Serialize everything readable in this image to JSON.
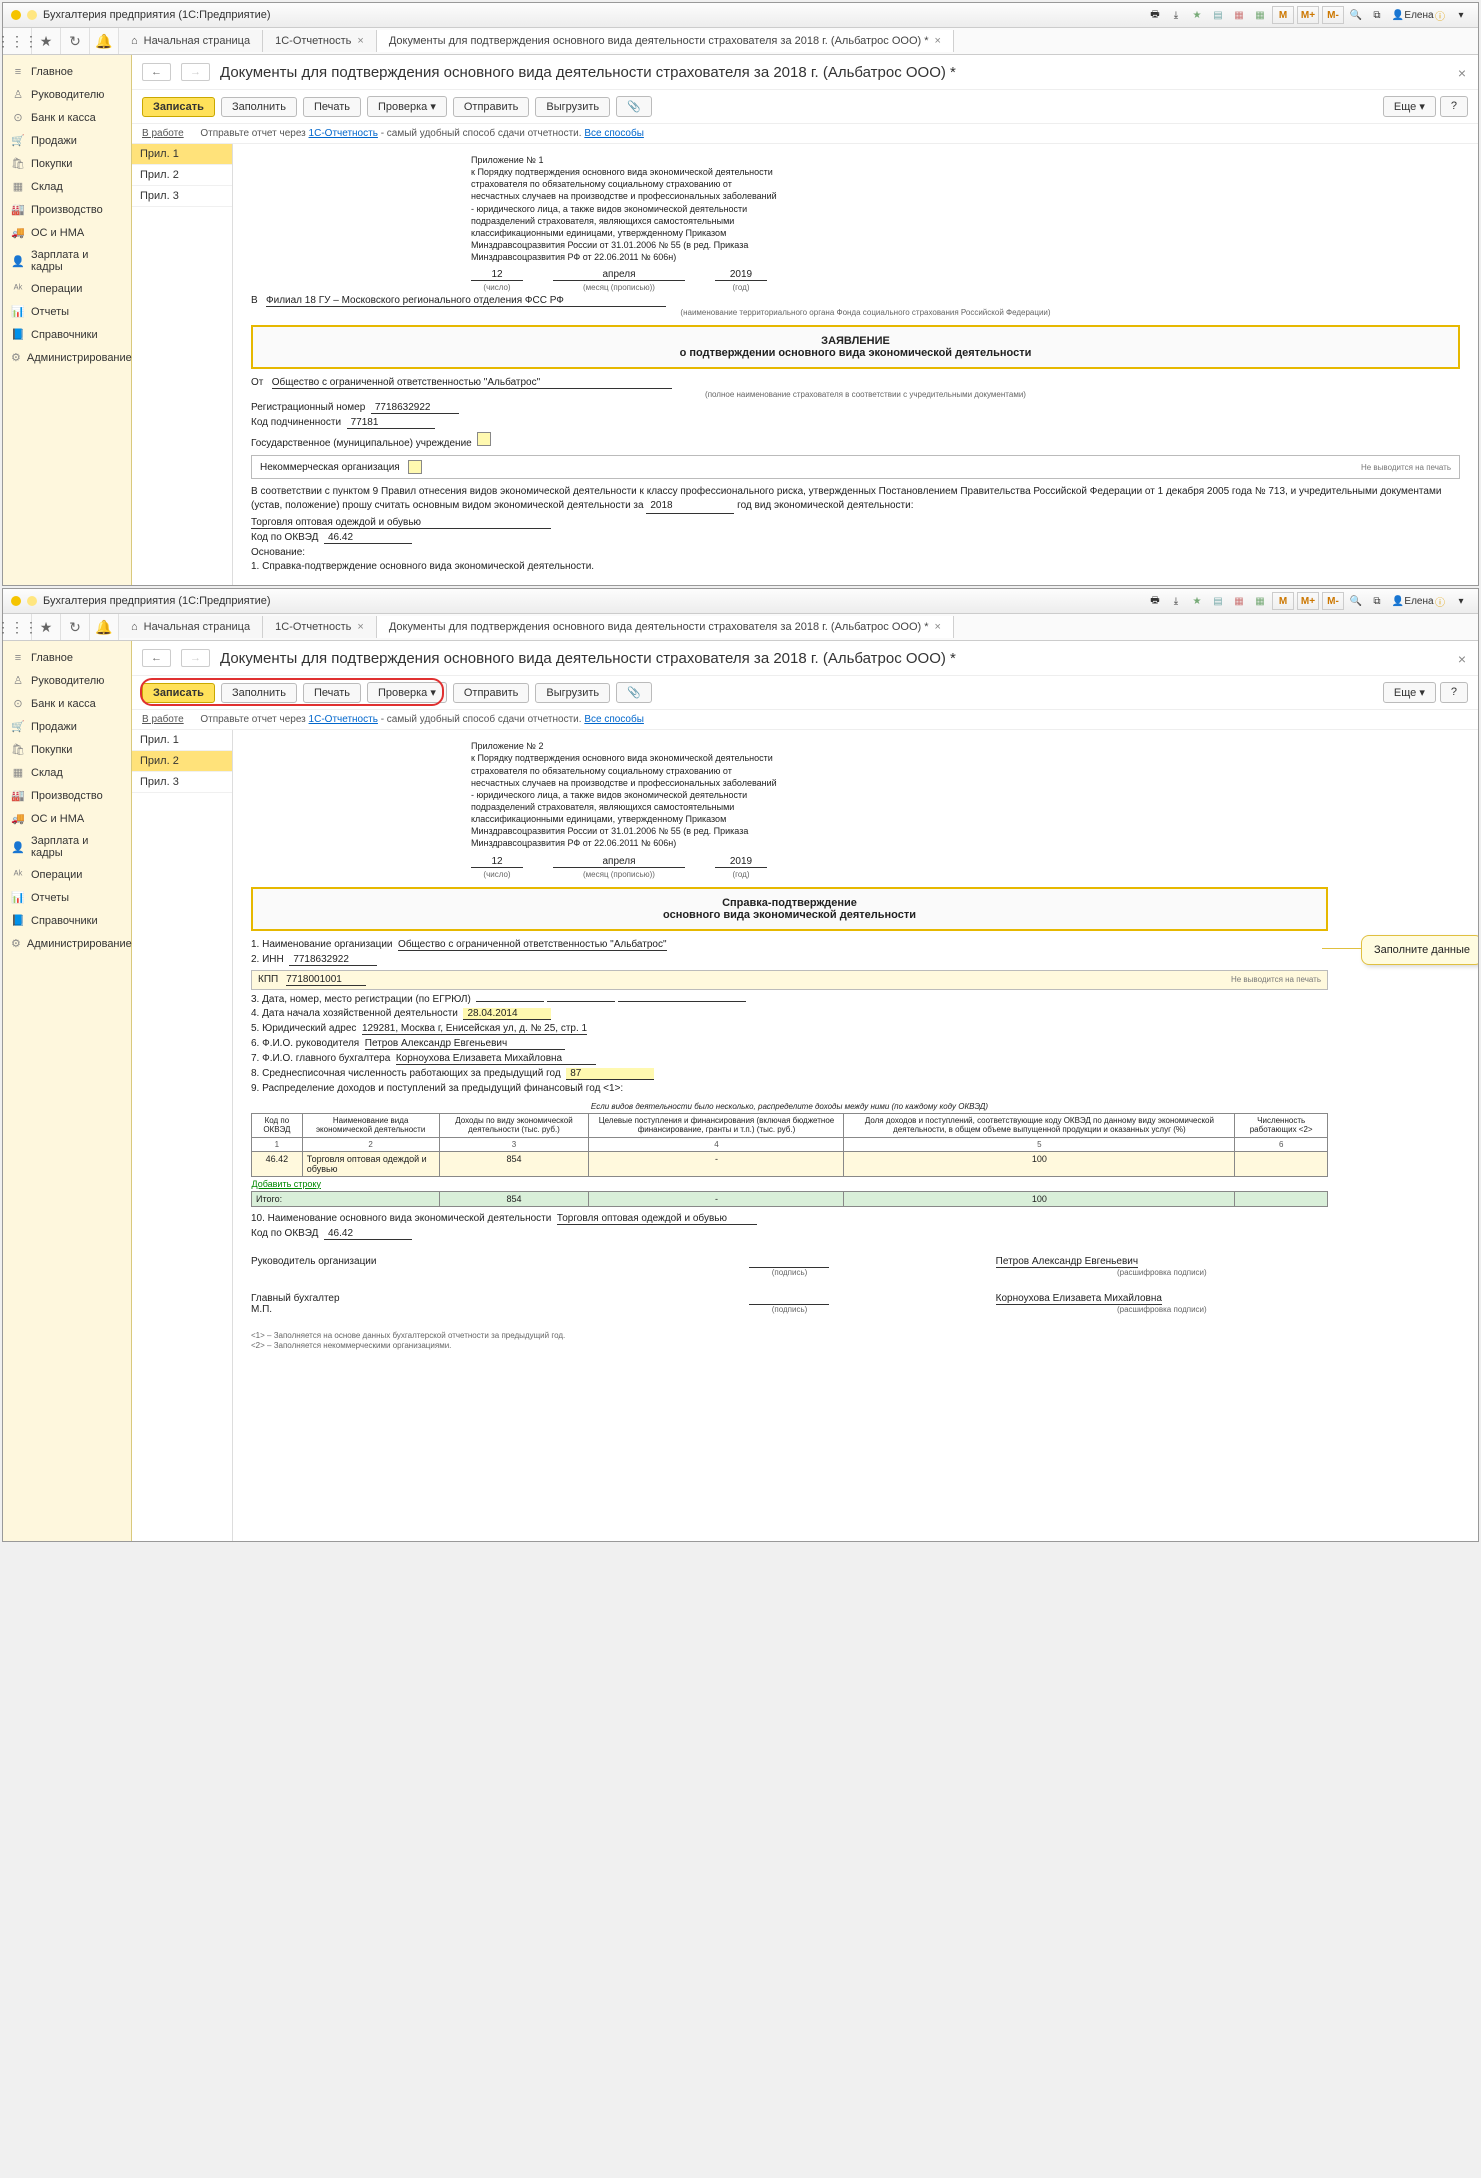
{
  "app": {
    "title": "Бухгалтерия предприятия   (1С:Предприятие)",
    "user": "Елена",
    "m_buttons": [
      "M",
      "M+",
      "M-"
    ]
  },
  "tabs": {
    "home": "Начальная страница",
    "t1": "1С-Отчетность",
    "t2": "Документы для подтверждения основного вида деятельности страхователя за 2018 г. (Альбатрос ООО) *"
  },
  "sidebar": [
    {
      "icon": "≡",
      "label": "Главное"
    },
    {
      "icon": "♙",
      "label": "Руководителю"
    },
    {
      "icon": "⊙",
      "label": "Банк и касса"
    },
    {
      "icon": "🛒",
      "label": "Продажи"
    },
    {
      "icon": "🛍",
      "label": "Покупки"
    },
    {
      "icon": "▦",
      "label": "Склад"
    },
    {
      "icon": "🏭",
      "label": "Производство"
    },
    {
      "icon": "🚚",
      "label": "ОС и НМА"
    },
    {
      "icon": "👤",
      "label": "Зарплата и кадры"
    },
    {
      "icon": "ᴬᵏ",
      "label": "Операции"
    },
    {
      "icon": "📊",
      "label": "Отчеты"
    },
    {
      "icon": "📘",
      "label": "Справочники"
    },
    {
      "icon": "⚙",
      "label": "Администрирование"
    }
  ],
  "page_title": "Документы для подтверждения основного вида деятельности страхователя за 2018 г. (Альбатрос ООО) *",
  "toolbar": {
    "save": "Записать",
    "fill": "Заполнить",
    "print": "Печать",
    "check": "Проверка",
    "send": "Отправить",
    "export": "Выгрузить",
    "more": "Еще"
  },
  "info": {
    "label": "В работе",
    "text1": "Отправьте отчет через ",
    "link1": "1С-Отчетность",
    "text2": " - самый удобный способ сдачи отчетности. ",
    "link2": "Все способы"
  },
  "attachments": [
    "Прил. 1",
    "Прил. 2",
    "Прил. 3"
  ],
  "doc1": {
    "appendix": "Приложение № 1",
    "appendix_text": "к Порядку подтверждения основного вида экономической деятельности страхователя по обязательному социальному страхованию от несчастных случаев на производстве и профессиональных заболеваний - юридического лица, а также видов экономической деятельности подразделений страхователя, являющихся самостоятельными классификационными единицами, утвержденному Приказом Минздравсоцразвития России от 31.01.2006 № 55 (в ред. Приказа Минздравсоцразвития РФ от 22.06.2011 № 606н)",
    "day": "12",
    "month": "апреля",
    "year": "2019",
    "day_l": "(число)",
    "month_l": "(месяц (прописью))",
    "year_l": "(год)",
    "to_l": "В",
    "to": "Филиал 18 ГУ – Московского регионального отделения ФСС РФ",
    "to_sub": "(наименование территориального органа Фонда социального страхования Российской Федерации)",
    "title1": "ЗАЯВЛЕНИЕ",
    "title2": "о подтверждении основного вида экономической деятельности",
    "from_l": "От",
    "from": "Общество с ограниченной ответственностью \"Альбатрос\"",
    "from_sub": "(полное наименование страхователя в соответствии с учредительными документами)",
    "reg_l": "Регистрационный номер",
    "reg": "7718632922",
    "sub_l": "Код подчиненности",
    "sub": "77181",
    "gos": "Государственное (муниципальное) учреждение",
    "nko": "Некоммерческая организация",
    "nko_note": "Не выводится на печать",
    "body": "В соответствии с пунктом 9 Правил отнесения видов экономической деятельности к классу профессионального риска, утвержденных Постановлением Правительства Российской Федерации от 1 декабря 2005 года № 713, и учредительными документами (устав, положение) прошу считать основным видом экономической деятельности за ",
    "body_year": "2018",
    "body2": " год вид экономической деятельности:",
    "activity": "Торговля оптовая одеждой и обувью",
    "okved_l": "Код по ОКВЭД",
    "okved": "46.42",
    "basis_l": "Основание:",
    "basis1": "1. Справка-подтверждение основного вида экономической деятельности."
  },
  "doc2": {
    "appendix": "Приложение № 2",
    "title1": "Справка-подтверждение",
    "title2": "основного вида экономической деятельности",
    "l1": "1. Наименование организации",
    "v1": "Общество с ограниченной ответственностью \"Альбатрос\"",
    "l2": "2. ИНН",
    "v2": "7718632922",
    "kpp_l": "КПП",
    "kpp": "7718001001",
    "kpp_note": "Не выводится на печать",
    "l3": "3. Дата, номер, место регистрации (по ЕГРЮЛ)",
    "l4": "4. Дата начала хозяйственной деятельности",
    "v4": "28.04.2014",
    "l5": "5. Юридический адрес",
    "v5": "129281, Москва г, Енисейская ул, д. № 25, стр. 1",
    "l6": "6. Ф.И.О. руководителя",
    "v6": "Петров Александр Евгеньевич",
    "l7": "7. Ф.И.О. главного бухгалтера",
    "v7": "Корноухова Елизавета Михайловна",
    "l8": "8. Среднесписочная численность работающих за предыдущий год",
    "v8": "87",
    "l9": "9. Распределение доходов и поступлений за предыдущий финансовый год <1>:",
    "tbl_note": "Если видов деятельности было несколько, распределите доходы между ними (по каждому коду ОКВЭД)",
    "th": [
      "Код по ОКВЭД",
      "Наименование вида экономической деятельности",
      "Доходы по виду экономической деятельности (тыс. руб.)",
      "Целевые поступления и финансирования (включая бюджетное финансирование, гранты и т.п.) (тыс. руб.)",
      "Доля доходов и поступлений, соответствующие коду ОКВЭД по данному виду экономической деятельности, в общем объеме выпущенной продукции и оказанных услуг (%)",
      "Численность работающих <2>"
    ],
    "row": [
      "46.42",
      "Торговля оптовая одеждой и обувью",
      "854",
      "-",
      "100",
      ""
    ],
    "add": "Добавить строку",
    "total_l": "Итого:",
    "total": [
      "854",
      "-",
      "100",
      ""
    ],
    "l10": "10. Наименование основного вида экономической деятельности",
    "v10": "Торговля оптовая одеждой и обувью",
    "okved_l": "Код по ОКВЭД",
    "okved": "46.42",
    "sig_head_l": "Руководитель организации",
    "sig_head": "Петров Александр Евгеньевич",
    "sig_acc_l": "Главный бухгалтер",
    "sig_acc_mp": "М.П.",
    "sig_acc": "Корноухова Елизавета Михайловна",
    "sig_sub1": "(подпись)",
    "sig_sub2": "(расшифровка подписи)",
    "fn1": "<1> – Заполняется на основе данных бухгалтерской отчетности за предыдущий год.",
    "fn2": "<2> – Заполняется некоммерческими организациями.",
    "callout": "Заполните данные"
  }
}
